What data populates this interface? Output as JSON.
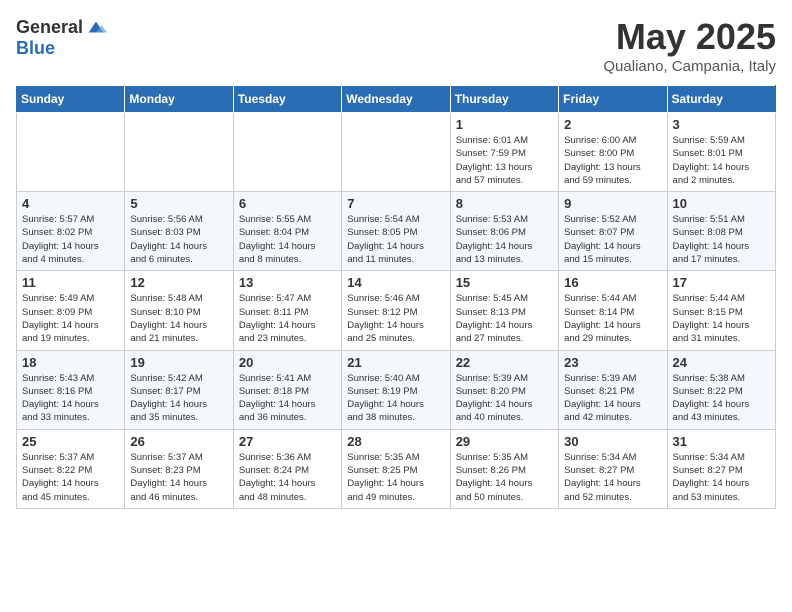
{
  "header": {
    "logo_general": "General",
    "logo_blue": "Blue",
    "month_title": "May 2025",
    "location": "Qualiano, Campania, Italy"
  },
  "days_of_week": [
    "Sunday",
    "Monday",
    "Tuesday",
    "Wednesday",
    "Thursday",
    "Friday",
    "Saturday"
  ],
  "weeks": [
    [
      {
        "day": "",
        "info": ""
      },
      {
        "day": "",
        "info": ""
      },
      {
        "day": "",
        "info": ""
      },
      {
        "day": "",
        "info": ""
      },
      {
        "day": "1",
        "info": "Sunrise: 6:01 AM\nSunset: 7:59 PM\nDaylight: 13 hours\nand 57 minutes."
      },
      {
        "day": "2",
        "info": "Sunrise: 6:00 AM\nSunset: 8:00 PM\nDaylight: 13 hours\nand 59 minutes."
      },
      {
        "day": "3",
        "info": "Sunrise: 5:59 AM\nSunset: 8:01 PM\nDaylight: 14 hours\nand 2 minutes."
      }
    ],
    [
      {
        "day": "4",
        "info": "Sunrise: 5:57 AM\nSunset: 8:02 PM\nDaylight: 14 hours\nand 4 minutes."
      },
      {
        "day": "5",
        "info": "Sunrise: 5:56 AM\nSunset: 8:03 PM\nDaylight: 14 hours\nand 6 minutes."
      },
      {
        "day": "6",
        "info": "Sunrise: 5:55 AM\nSunset: 8:04 PM\nDaylight: 14 hours\nand 8 minutes."
      },
      {
        "day": "7",
        "info": "Sunrise: 5:54 AM\nSunset: 8:05 PM\nDaylight: 14 hours\nand 11 minutes."
      },
      {
        "day": "8",
        "info": "Sunrise: 5:53 AM\nSunset: 8:06 PM\nDaylight: 14 hours\nand 13 minutes."
      },
      {
        "day": "9",
        "info": "Sunrise: 5:52 AM\nSunset: 8:07 PM\nDaylight: 14 hours\nand 15 minutes."
      },
      {
        "day": "10",
        "info": "Sunrise: 5:51 AM\nSunset: 8:08 PM\nDaylight: 14 hours\nand 17 minutes."
      }
    ],
    [
      {
        "day": "11",
        "info": "Sunrise: 5:49 AM\nSunset: 8:09 PM\nDaylight: 14 hours\nand 19 minutes."
      },
      {
        "day": "12",
        "info": "Sunrise: 5:48 AM\nSunset: 8:10 PM\nDaylight: 14 hours\nand 21 minutes."
      },
      {
        "day": "13",
        "info": "Sunrise: 5:47 AM\nSunset: 8:11 PM\nDaylight: 14 hours\nand 23 minutes."
      },
      {
        "day": "14",
        "info": "Sunrise: 5:46 AM\nSunset: 8:12 PM\nDaylight: 14 hours\nand 25 minutes."
      },
      {
        "day": "15",
        "info": "Sunrise: 5:45 AM\nSunset: 8:13 PM\nDaylight: 14 hours\nand 27 minutes."
      },
      {
        "day": "16",
        "info": "Sunrise: 5:44 AM\nSunset: 8:14 PM\nDaylight: 14 hours\nand 29 minutes."
      },
      {
        "day": "17",
        "info": "Sunrise: 5:44 AM\nSunset: 8:15 PM\nDaylight: 14 hours\nand 31 minutes."
      }
    ],
    [
      {
        "day": "18",
        "info": "Sunrise: 5:43 AM\nSunset: 8:16 PM\nDaylight: 14 hours\nand 33 minutes."
      },
      {
        "day": "19",
        "info": "Sunrise: 5:42 AM\nSunset: 8:17 PM\nDaylight: 14 hours\nand 35 minutes."
      },
      {
        "day": "20",
        "info": "Sunrise: 5:41 AM\nSunset: 8:18 PM\nDaylight: 14 hours\nand 36 minutes."
      },
      {
        "day": "21",
        "info": "Sunrise: 5:40 AM\nSunset: 8:19 PM\nDaylight: 14 hours\nand 38 minutes."
      },
      {
        "day": "22",
        "info": "Sunrise: 5:39 AM\nSunset: 8:20 PM\nDaylight: 14 hours\nand 40 minutes."
      },
      {
        "day": "23",
        "info": "Sunrise: 5:39 AM\nSunset: 8:21 PM\nDaylight: 14 hours\nand 42 minutes."
      },
      {
        "day": "24",
        "info": "Sunrise: 5:38 AM\nSunset: 8:22 PM\nDaylight: 14 hours\nand 43 minutes."
      }
    ],
    [
      {
        "day": "25",
        "info": "Sunrise: 5:37 AM\nSunset: 8:22 PM\nDaylight: 14 hours\nand 45 minutes."
      },
      {
        "day": "26",
        "info": "Sunrise: 5:37 AM\nSunset: 8:23 PM\nDaylight: 14 hours\nand 46 minutes."
      },
      {
        "day": "27",
        "info": "Sunrise: 5:36 AM\nSunset: 8:24 PM\nDaylight: 14 hours\nand 48 minutes."
      },
      {
        "day": "28",
        "info": "Sunrise: 5:35 AM\nSunset: 8:25 PM\nDaylight: 14 hours\nand 49 minutes."
      },
      {
        "day": "29",
        "info": "Sunrise: 5:35 AM\nSunset: 8:26 PM\nDaylight: 14 hours\nand 50 minutes."
      },
      {
        "day": "30",
        "info": "Sunrise: 5:34 AM\nSunset: 8:27 PM\nDaylight: 14 hours\nand 52 minutes."
      },
      {
        "day": "31",
        "info": "Sunrise: 5:34 AM\nSunset: 8:27 PM\nDaylight: 14 hours\nand 53 minutes."
      }
    ]
  ]
}
